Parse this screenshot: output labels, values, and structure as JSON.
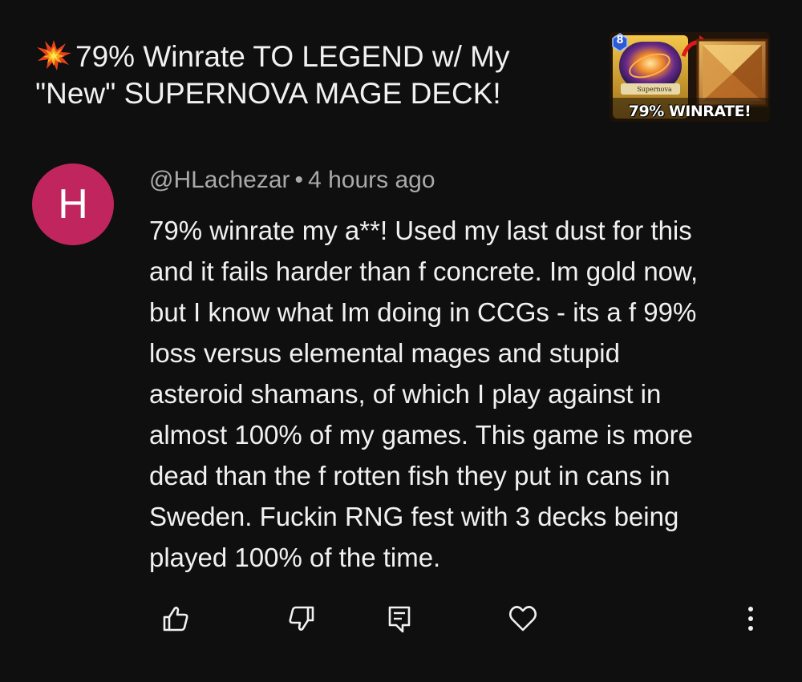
{
  "video": {
    "title_icon": "collision-icon",
    "title": "79% Winrate TO LEGEND w/ My \"New\" SUPERNOVA MAGE DECK!",
    "thumbnail": {
      "card_cost": "8",
      "card_name": "Supernova",
      "caption": "79% WINRATE!"
    }
  },
  "comment": {
    "avatar_letter": "H",
    "avatar_color": "#c0265d",
    "author": "@HLachezar",
    "separator": "•",
    "time": "4 hours ago",
    "lines": [
      "79% winrate my a**! Used my last dust for this",
      "and it fails harder than f concrete. Im gold now,",
      "but I know what Im doing in CCGs - its a f 99%",
      "loss versus elemental mages and stupid",
      "asteroid shamans, of which I play against in",
      "almost 100% of my games. This game is more",
      "dead than the f rotten fish they put in cans in",
      "Sweden. Fuckin RNG fest with 3 decks being",
      "played 100% of the time."
    ]
  },
  "actions": [
    {
      "icon": "thumbs-up-icon"
    },
    {
      "icon": "thumbs-down-icon"
    },
    {
      "icon": "reply-icon"
    },
    {
      "icon": "heart-icon"
    },
    {
      "icon": "more-vertical-icon"
    }
  ]
}
